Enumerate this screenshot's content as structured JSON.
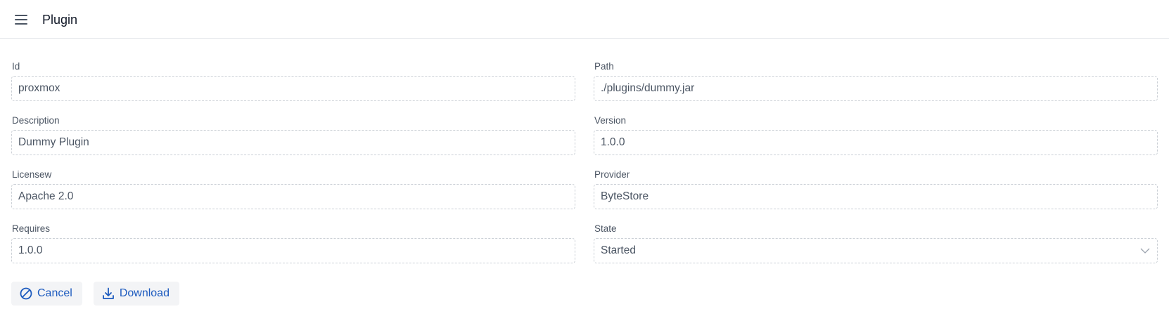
{
  "header": {
    "title": "Plugin",
    "menu_icon": "hamburger-menu-icon"
  },
  "form": {
    "id": {
      "label": "Id",
      "value": "proxmox"
    },
    "path": {
      "label": "Path",
      "value": "./plugins/dummy.jar"
    },
    "description": {
      "label": "Description",
      "value": "Dummy Plugin"
    },
    "version": {
      "label": "Version",
      "value": "1.0.0"
    },
    "license": {
      "label": "Licensew",
      "value": "Apache 2.0"
    },
    "provider": {
      "label": "Provider",
      "value": "ByteStore"
    },
    "requires": {
      "label": "Requires",
      "value": "1.0.0"
    },
    "state": {
      "label": "State",
      "value": "Started",
      "icon": "chevron-down-icon"
    }
  },
  "actions": {
    "cancel": {
      "label": "Cancel",
      "icon": "ban-icon"
    },
    "download": {
      "label": "Download",
      "icon": "download-icon"
    }
  },
  "colors": {
    "accent": "#1d5bbf",
    "border": "#cbd0d6",
    "button_bg": "#f3f4f6"
  }
}
